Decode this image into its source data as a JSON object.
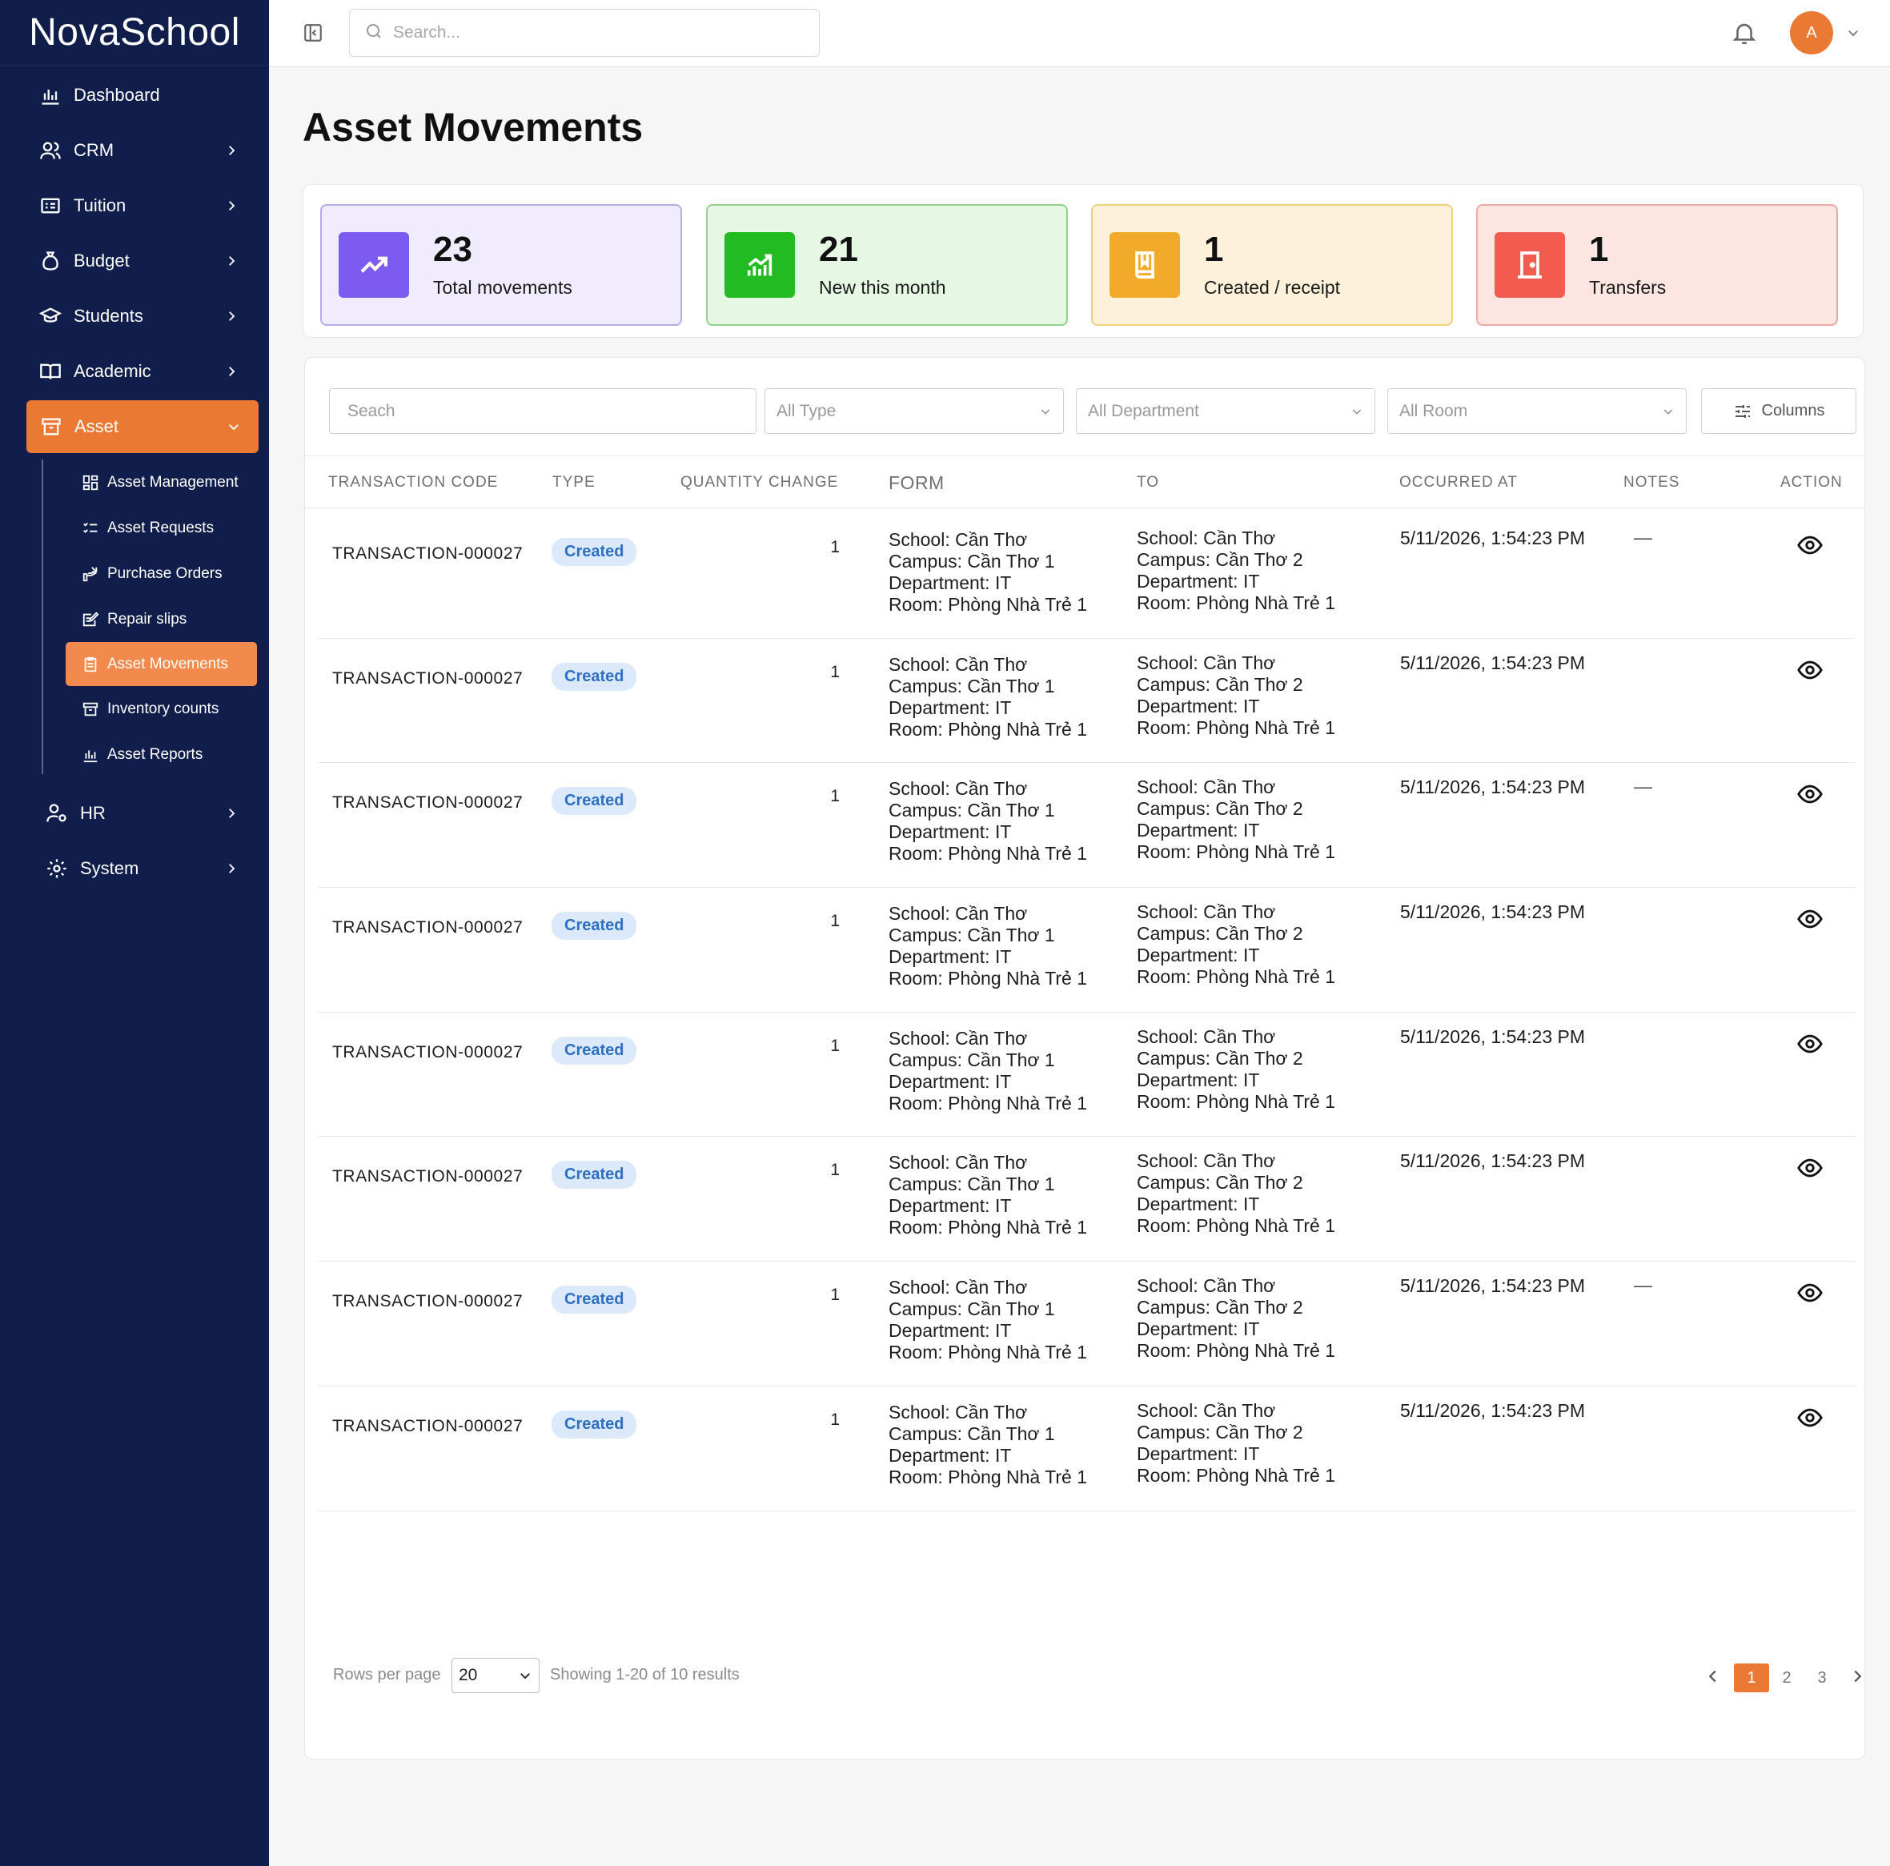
{
  "app": {
    "logo": "NovaSchool"
  },
  "sidebar": {
    "items": [
      {
        "label": "Dashboard",
        "icon": "bar-chart-icon",
        "chevron": false
      },
      {
        "label": "CRM",
        "icon": "users-icon",
        "chevron": true
      },
      {
        "label": "Tuition",
        "icon": "tuition-icon",
        "chevron": true
      },
      {
        "label": "Budget",
        "icon": "money-bag-icon",
        "chevron": true
      },
      {
        "label": "Students",
        "icon": "graduation-cap-icon",
        "chevron": true
      },
      {
        "label": "Academic",
        "icon": "book-open-icon",
        "chevron": true
      },
      {
        "label": "Asset",
        "icon": "archive-icon",
        "chevron": true,
        "expanded": true
      }
    ],
    "asset_sub": [
      {
        "label": "Asset Management",
        "icon": "grid-icon"
      },
      {
        "label": "Asset Requests",
        "icon": "checklist-icon"
      },
      {
        "label": "Purchase Orders",
        "icon": "purchase-icon"
      },
      {
        "label": "Repair slips",
        "icon": "repair-slip-icon"
      },
      {
        "label": "Asset Movements",
        "icon": "clipboard-icon",
        "active": true
      },
      {
        "label": "Inventory counts",
        "icon": "inventory-icon"
      },
      {
        "label": "Asset Reports",
        "icon": "report-chart-icon"
      }
    ],
    "bottom": [
      {
        "label": "HR",
        "icon": "user-settings-icon"
      },
      {
        "label": "System",
        "icon": "gear-icon"
      }
    ]
  },
  "topbar": {
    "search_placeholder": "Search...",
    "avatar_initial": "A"
  },
  "page": {
    "title": "Asset Movements"
  },
  "stats": [
    {
      "value": "23",
      "label": "Total movements",
      "icon": "trend-up-icon",
      "color": "#7c5cf0"
    },
    {
      "value": "21",
      "label": "New this month",
      "icon": "growth-chart-icon",
      "color": "#22bb22"
    },
    {
      "value": "1",
      "label": "Created / receipt",
      "icon": "book-icon",
      "color": "#f2ab28"
    },
    {
      "value": "1",
      "label": "Transfers",
      "icon": "door-icon",
      "color": "#f25b50"
    }
  ],
  "filters": {
    "search_placeholder": "Seach",
    "type": "All Type",
    "department": "All Department",
    "room": "All Room",
    "columns_label": "Columns"
  },
  "table": {
    "columns": [
      "TRANSACTION CODE",
      "TYPE",
      "QUANTITY CHANGE",
      "FORM",
      "TO",
      "OCCURRED AT",
      "NOTES",
      "ACTION"
    ],
    "rows": [
      {
        "code": "TRANSACTION-000027",
        "type": "Created",
        "qty": "1",
        "from": [
          "School: Cần Thơ",
          "Campus: Cần Thơ 1",
          "Department: IT",
          "Room: Phòng Nhà Trẻ 1"
        ],
        "to": [
          "School: Cần Thơ",
          "Campus: Cần Thơ 2",
          "Department: IT",
          "Room: Phòng Nhà Trẻ 1"
        ],
        "date": "5/11/2026, 1:54:23 PM",
        "notes": "—"
      },
      {
        "code": "TRANSACTION-000027",
        "type": "Created",
        "qty": "1",
        "from": [
          "School: Cần Thơ",
          "Campus: Cần Thơ 1",
          "Department: IT",
          "Room: Phòng Nhà Trẻ 1"
        ],
        "to": [
          "School: Cần Thơ",
          "Campus: Cần Thơ 2",
          "Department: IT",
          "Room: Phòng Nhà Trẻ 1"
        ],
        "date": "5/11/2026, 1:54:23 PM",
        "notes": ""
      },
      {
        "code": "TRANSACTION-000027",
        "type": "Created",
        "qty": "1",
        "from": [
          "School: Cần Thơ",
          "Campus: Cần Thơ 1",
          "Department: IT",
          "Room: Phòng Nhà Trẻ 1"
        ],
        "to": [
          "School: Cần Thơ",
          "Campus: Cần Thơ 2",
          "Department: IT",
          "Room: Phòng Nhà Trẻ 1"
        ],
        "date": "5/11/2026, 1:54:23 PM",
        "notes": "—"
      },
      {
        "code": "TRANSACTION-000027",
        "type": "Created",
        "qty": "1",
        "from": [
          "School: Cần Thơ",
          "Campus: Cần Thơ 1",
          "Department: IT",
          "Room: Phòng Nhà Trẻ 1"
        ],
        "to": [
          "School: Cần Thơ",
          "Campus: Cần Thơ 2",
          "Department: IT",
          "Room: Phòng Nhà Trẻ 1"
        ],
        "date": "5/11/2026, 1:54:23 PM",
        "notes": ""
      },
      {
        "code": "TRANSACTION-000027",
        "type": "Created",
        "qty": "1",
        "from": [
          "School: Cần Thơ",
          "Campus: Cần Thơ 1",
          "Department: IT",
          "Room: Phòng Nhà Trẻ 1"
        ],
        "to": [
          "School: Cần Thơ",
          "Campus: Cần Thơ 2",
          "Department: IT",
          "Room: Phòng Nhà Trẻ 1"
        ],
        "date": "5/11/2026, 1:54:23 PM",
        "notes": ""
      },
      {
        "code": "TRANSACTION-000027",
        "type": "Created",
        "qty": "1",
        "from": [
          "School: Cần Thơ",
          "Campus: Cần Thơ 1",
          "Department: IT",
          "Room: Phòng Nhà Trẻ 1"
        ],
        "to": [
          "School: Cần Thơ",
          "Campus: Cần Thơ 2",
          "Department: IT",
          "Room: Phòng Nhà Trẻ 1"
        ],
        "date": "5/11/2026, 1:54:23 PM",
        "notes": ""
      },
      {
        "code": "TRANSACTION-000027",
        "type": "Created",
        "qty": "1",
        "from": [
          "School: Cần Thơ",
          "Campus: Cần Thơ 1",
          "Department: IT",
          "Room: Phòng Nhà Trẻ 1"
        ],
        "to": [
          "School: Cần Thơ",
          "Campus: Cần Thơ 2",
          "Department: IT",
          "Room: Phòng Nhà Trẻ 1"
        ],
        "date": "5/11/2026, 1:54:23 PM",
        "notes": "—"
      },
      {
        "code": "TRANSACTION-000027",
        "type": "Created",
        "qty": "1",
        "from": [
          "School: Cần Thơ",
          "Campus: Cần Thơ 1",
          "Department: IT",
          "Room: Phòng Nhà Trẻ 1"
        ],
        "to": [
          "School: Cần Thơ",
          "Campus: Cần Thơ 2",
          "Department: IT",
          "Room: Phòng Nhà Trẻ 1"
        ],
        "date": "5/11/2026, 1:54:23 PM",
        "notes": ""
      }
    ]
  },
  "pagination": {
    "rows_per_page_label": "Rows per page",
    "rows_per_page": "20",
    "showing": "Showing 1-20 of 10 results",
    "pages": [
      "1",
      "2",
      "3"
    ],
    "current": "1"
  }
}
